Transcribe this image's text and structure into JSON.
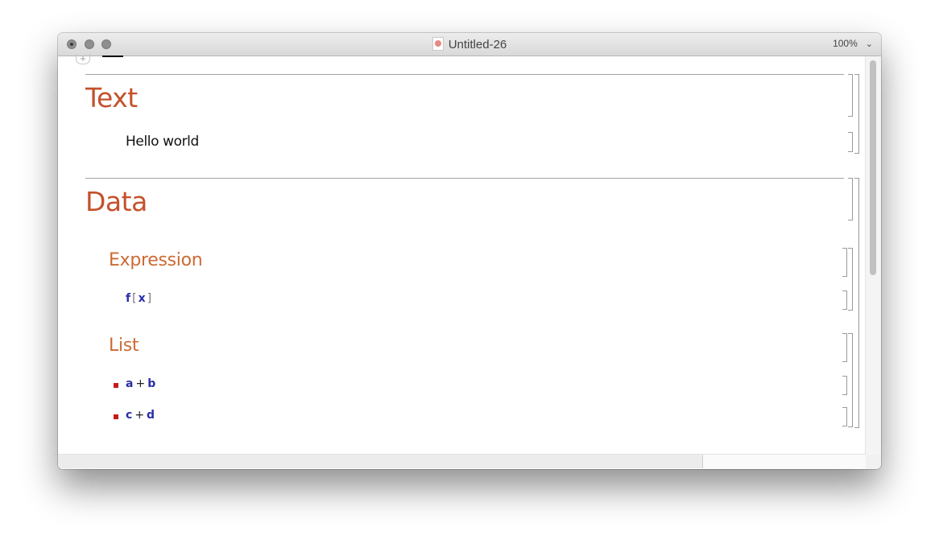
{
  "window": {
    "title": "Untitled-26",
    "zoom_label": "100%",
    "zoom_menu_icon": "chevron-down-icon"
  },
  "notebook": {
    "sections": [
      {
        "title": "Text",
        "cells": [
          {
            "type": "text",
            "content": "Hello world"
          }
        ]
      },
      {
        "title": "Data",
        "subsections": [
          {
            "title": "Expression",
            "code": {
              "head": "f",
              "open": "[",
              "arg": "x",
              "close": "]"
            }
          },
          {
            "title": "List",
            "items": [
              {
                "left": "a",
                "op": "+",
                "right": "b"
              },
              {
                "left": "c",
                "op": "+",
                "right": "d"
              }
            ]
          }
        ]
      }
    ]
  },
  "colors": {
    "section_title": "#c4512b",
    "subsection_title": "#cd6a34",
    "code_symbol": "#2a2ea8",
    "bullet": "#c51b1b"
  }
}
